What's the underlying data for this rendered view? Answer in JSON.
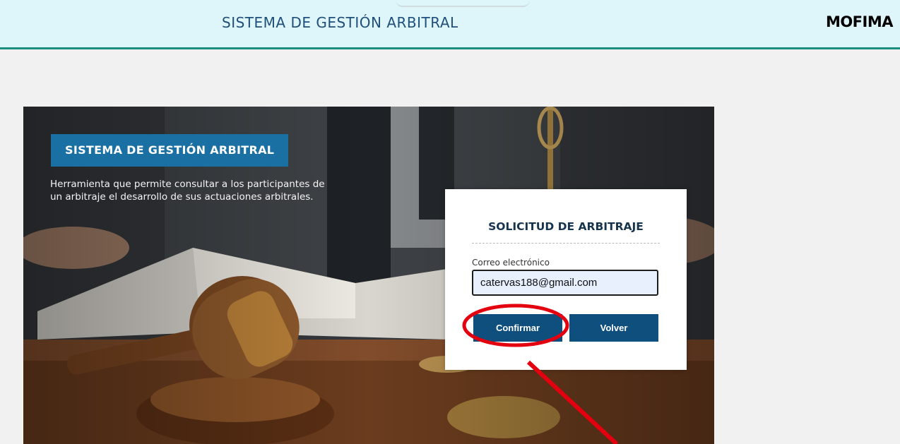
{
  "header": {
    "title": "SISTEMA DE GESTIÓN ARBITRAL",
    "brand": "MOFIMA",
    "background": "#def6f9",
    "accent": "#1d8d7d"
  },
  "hero": {
    "badge": "SISTEMA DE GESTIÓN ARBITRAL",
    "description": "Herramienta que permite consultar a los participantes de un arbitraje el desarrollo de sus actuaciones arbitrales."
  },
  "form": {
    "title": "SOLICITUD DE ARBITRAJE",
    "email_label": "Correo electrónico",
    "email_value": "catervas188@gmail.com",
    "confirm_label": "Confirmar",
    "back_label": "Volver",
    "button_color": "#0f4f7d"
  },
  "annotation": {
    "highlight_color": "#e3000f",
    "target": "confirm-button"
  }
}
